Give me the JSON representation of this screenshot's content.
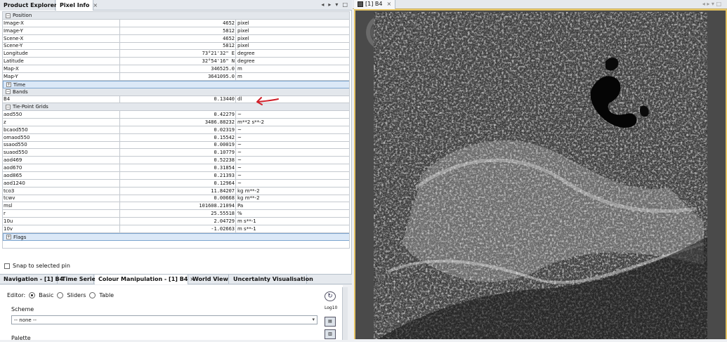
{
  "left_tabs": [
    {
      "label": "Product Explorer"
    },
    {
      "label": "Pixel Info",
      "close": "×"
    }
  ],
  "window_buttons": [
    "◂",
    "▸",
    "▾",
    "□"
  ],
  "pixel_info": {
    "groups": {
      "position": "Position",
      "time": "Time",
      "bands": "Bands",
      "tpg": "Tie-Point Grids",
      "flags": "Flags"
    },
    "position_rows": [
      {
        "name": "Image-X",
        "value": "4652",
        "unit": "pixel"
      },
      {
        "name": "Image-Y",
        "value": "5812",
        "unit": "pixel"
      },
      {
        "name": "Scene-X",
        "value": "4652",
        "unit": "pixel"
      },
      {
        "name": "Scene-Y",
        "value": "5812",
        "unit": "pixel"
      },
      {
        "name": "Longitude",
        "value": "73°21'32\" E",
        "unit": "degree"
      },
      {
        "name": "Latitude",
        "value": "32°54'16\" N",
        "unit": "degree"
      },
      {
        "name": "Map-X",
        "value": "346525.0",
        "unit": "m"
      },
      {
        "name": "Map-Y",
        "value": "3641095.0",
        "unit": "m"
      }
    ],
    "band_rows": [
      {
        "name": "B4",
        "value": "0.13440",
        "unit": "dl"
      }
    ],
    "tpg_rows": [
      {
        "name": "aod550",
        "value": "0.42279",
        "unit": "~"
      },
      {
        "name": "z",
        "value": "3486.88232",
        "unit": "m**2 s**-2"
      },
      {
        "name": "bcaod550",
        "value": "0.02319",
        "unit": "~"
      },
      {
        "name": "omaod550",
        "value": "0.15542",
        "unit": "~"
      },
      {
        "name": "ssaod550",
        "value": "0.00019",
        "unit": "~"
      },
      {
        "name": "suaod550",
        "value": "0.10779",
        "unit": "~"
      },
      {
        "name": "aod469",
        "value": "0.52238",
        "unit": "~"
      },
      {
        "name": "aod670",
        "value": "0.31854",
        "unit": "~"
      },
      {
        "name": "aod865",
        "value": "0.21393",
        "unit": "~"
      },
      {
        "name": "aod1240",
        "value": "0.12964",
        "unit": "~"
      },
      {
        "name": "tco3",
        "value": "11.84207",
        "unit": "kg m**-2"
      },
      {
        "name": "tcwv",
        "value": "0.00668",
        "unit": "kg m**-2"
      },
      {
        "name": "msl",
        "value": "101608.21094",
        "unit": "Pa"
      },
      {
        "name": "r",
        "value": "25.55518",
        "unit": "%"
      },
      {
        "name": "10u",
        "value": "2.04729",
        "unit": "m s**-1"
      },
      {
        "name": "10v",
        "value": "-1.02663",
        "unit": "m s**-1"
      }
    ],
    "snap_label": "Snap to selected pin"
  },
  "annotation_color": "#d0202a",
  "bottom_tabs": [
    {
      "label": "Navigation - [1] B4"
    },
    {
      "label": "Time Series"
    },
    {
      "label": "Colour Manipulation - [1] B4",
      "close": "×"
    },
    {
      "label": "World View"
    },
    {
      "label": "Uncertainty Visualisation"
    }
  ],
  "colour_manipulation": {
    "editor_label": "Editor:",
    "modes": [
      "Basic",
      "Sliders",
      "Table"
    ],
    "selected_mode": "Basic",
    "scheme_label": "Scheme",
    "scheme_value": "-- none --",
    "palette_label": "Palette",
    "log_label": "Log10"
  },
  "image_view": {
    "tab_label": "[1] B4",
    "tab_close": "×",
    "nav_arrows": "◂ ▸ ▾ □"
  }
}
